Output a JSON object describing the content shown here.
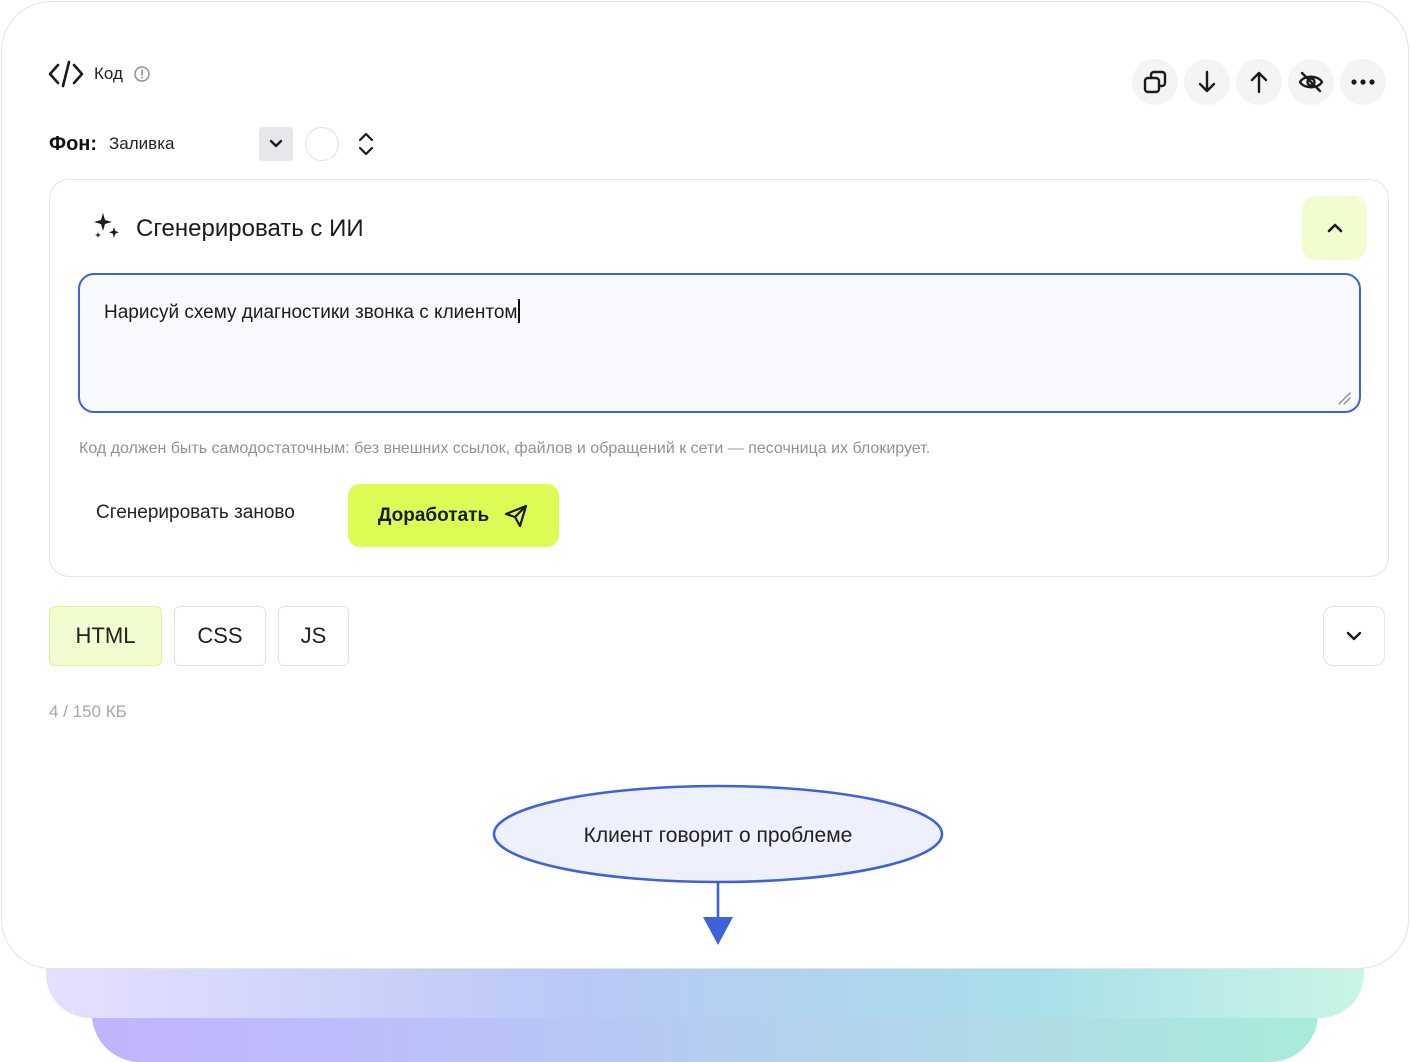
{
  "header": {
    "title": "Код",
    "toolbar": [
      "duplicate",
      "move-down",
      "move-up",
      "hide",
      "more"
    ]
  },
  "background": {
    "label": "Фон:",
    "value": "Заливка"
  },
  "ai_panel": {
    "title": "Сгенерировать с ИИ",
    "prompt_value": "Нарисуй схему диагностики звонка с клиентом",
    "hint": "Код должен быть самодостаточным: без внешних ссылок, файлов и обращений к сети — песочница их блокирует.",
    "regenerate_label": "Сгенерировать заново",
    "refine_label": "Доработать"
  },
  "tabs": [
    {
      "label": "HTML",
      "active": true
    },
    {
      "label": "CSS",
      "active": false
    },
    {
      "label": "JS",
      "active": false
    }
  ],
  "size_info": "4 / 150 КБ",
  "preview": {
    "node_label": "Клиент говорит о проблеме"
  },
  "colors": {
    "accent_lime": "#dcfb55",
    "accent_blue": "#3d63d9",
    "node_fill": "#eef0fb"
  }
}
